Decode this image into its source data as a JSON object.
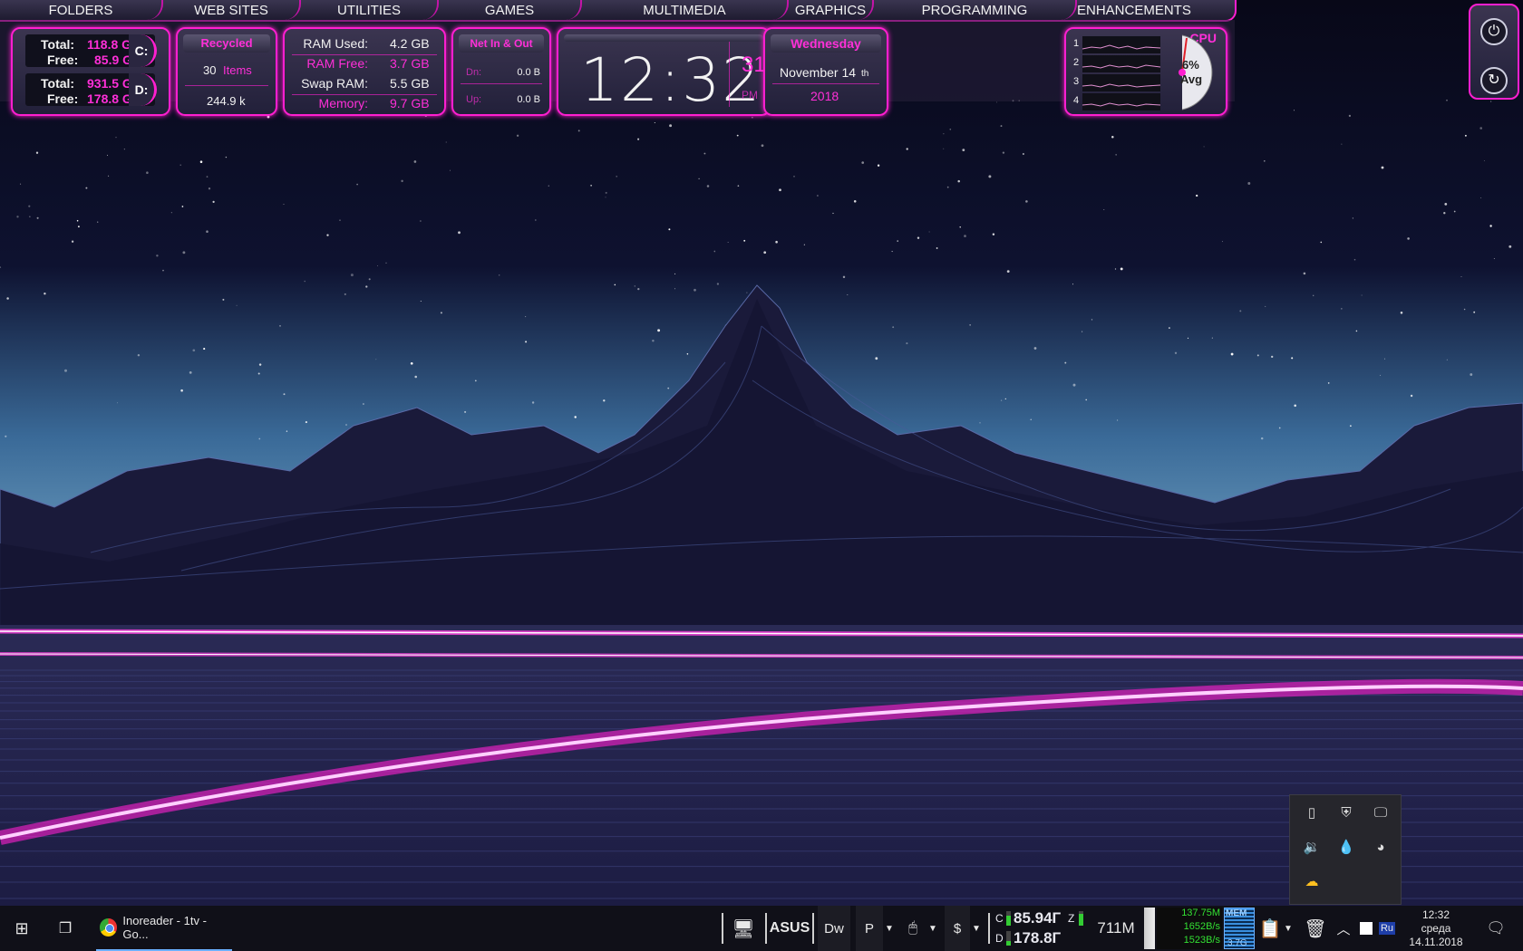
{
  "launcher": {
    "tabs": [
      "FOLDERS",
      "WEB SITES",
      "UTILITIES",
      "GAMES",
      "MULTIMEDIA",
      "GRAPHICS",
      "PROGRAMMING",
      "ENHANCEMENTS"
    ]
  },
  "drives": [
    {
      "letter": "C:",
      "total_label": "Total:",
      "total": "118.8 GB",
      "free_label": "Free:",
      "free": "85.9 GB"
    },
    {
      "letter": "D:",
      "total_label": "Total:",
      "total": "931.5 GB",
      "free_label": "Free:",
      "free": "178.8 GB"
    }
  ],
  "recycle": {
    "title": "Recycled",
    "count": "30",
    "items_label": "Items",
    "size": "244.9 k"
  },
  "memory": {
    "ram_used_label": "RAM Used:",
    "ram_used": "4.2 GB",
    "ram_free_label": "RAM Free:",
    "ram_free": "3.7 GB",
    "swap_label": "Swap RAM:",
    "swap": "5.5 GB",
    "memory_label": "Memory:",
    "memory": "9.7 GB"
  },
  "network": {
    "title": "Net In & Out",
    "dn_label": "Dn:",
    "dn": "0.0 B",
    "up_label": "Up:",
    "up": "0.0 B"
  },
  "clock": {
    "time": "12:32",
    "seconds": "31",
    "ampm": "PM"
  },
  "date": {
    "weekday": "Wednesday",
    "month_day": "November 14",
    "suffix": "th",
    "year": "2018"
  },
  "cpu": {
    "title": "CPU",
    "cores": [
      "1",
      "2",
      "3",
      "4"
    ],
    "percent": "6%",
    "avg_label": "Avg"
  },
  "taskbar": {
    "active_app": "Inoreader - 1tv - Go...",
    "asus": "ASUS",
    "dw": "Dw",
    "p": "P",
    "dollar": "$",
    "drive_c_letter": "C",
    "drive_c_free": "85.94Г",
    "drive_d_letter": "D",
    "drive_d_free": "178.8Г",
    "z_letter": "Z",
    "mem_free": "711M",
    "net_total": "137.75M",
    "net_rate1": "1652B/s",
    "net_rate2": "1523B/s",
    "mem_label": "MEM",
    "mem_total": "3.7G",
    "lang": "Ru",
    "time": "12:32",
    "day": "среда",
    "date": "14.11.2018"
  },
  "colors": {
    "accent": "#ff1fd0",
    "panel": "#2c2842",
    "taskbar": "#101018"
  }
}
